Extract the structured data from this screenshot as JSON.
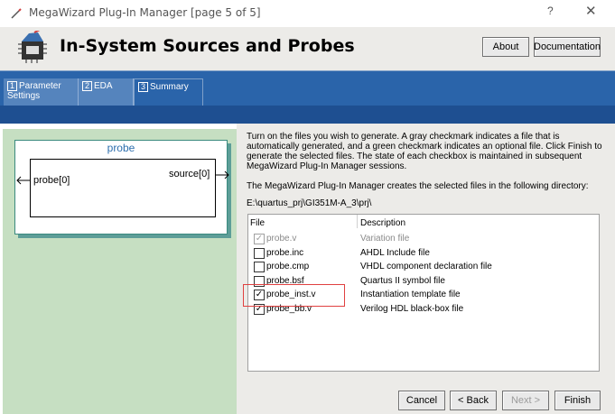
{
  "window": {
    "title": "MegaWizard Plug-In Manager [page 5 of 5]",
    "help_label": "?",
    "close_label": "✕"
  },
  "header": {
    "heading": "In-System Sources and Probes",
    "about_label": "About",
    "documentation_label": "Documentation"
  },
  "tabs": [
    {
      "num": "1",
      "label": "Parameter Settings"
    },
    {
      "num": "2",
      "label": "EDA"
    },
    {
      "num": "3",
      "label": "Summary"
    }
  ],
  "symbol": {
    "name": "probe",
    "input_port": "probe[0]",
    "output_port": "source[0]"
  },
  "summary": {
    "description": "Turn on the files you wish to generate. A gray checkmark indicates a file that is automatically generated, and a green checkmark indicates an optional file. Click Finish to generate the selected files. The state of each checkbox is maintained in subsequent MegaWizard Plug-In Manager sessions.",
    "dir_note": "The MegaWizard Plug-In Manager creates the selected files in the following directory:",
    "directory": "E:\\quartus_prj\\GI351M-A_3\\prj\\"
  },
  "file_table": {
    "headers": {
      "file": "File",
      "description": "Description"
    },
    "rows": [
      {
        "file": "probe.v",
        "description": "Variation file",
        "checked": true,
        "disabled": true
      },
      {
        "file": "probe.inc",
        "description": "AHDL Include file",
        "checked": false,
        "disabled": false
      },
      {
        "file": "probe.cmp",
        "description": "VHDL component declaration file",
        "checked": false,
        "disabled": false
      },
      {
        "file": "probe.bsf",
        "description": "Quartus II symbol file",
        "checked": false,
        "disabled": false
      },
      {
        "file": "probe_inst.v",
        "description": "Instantiation template file",
        "checked": true,
        "disabled": false
      },
      {
        "file": "probe_bb.v",
        "description": "Verilog HDL black-box file",
        "checked": true,
        "disabled": false
      }
    ]
  },
  "buttons": {
    "cancel": "Cancel",
    "back": "< Back",
    "next": "Next >",
    "finish": "Finish"
  }
}
